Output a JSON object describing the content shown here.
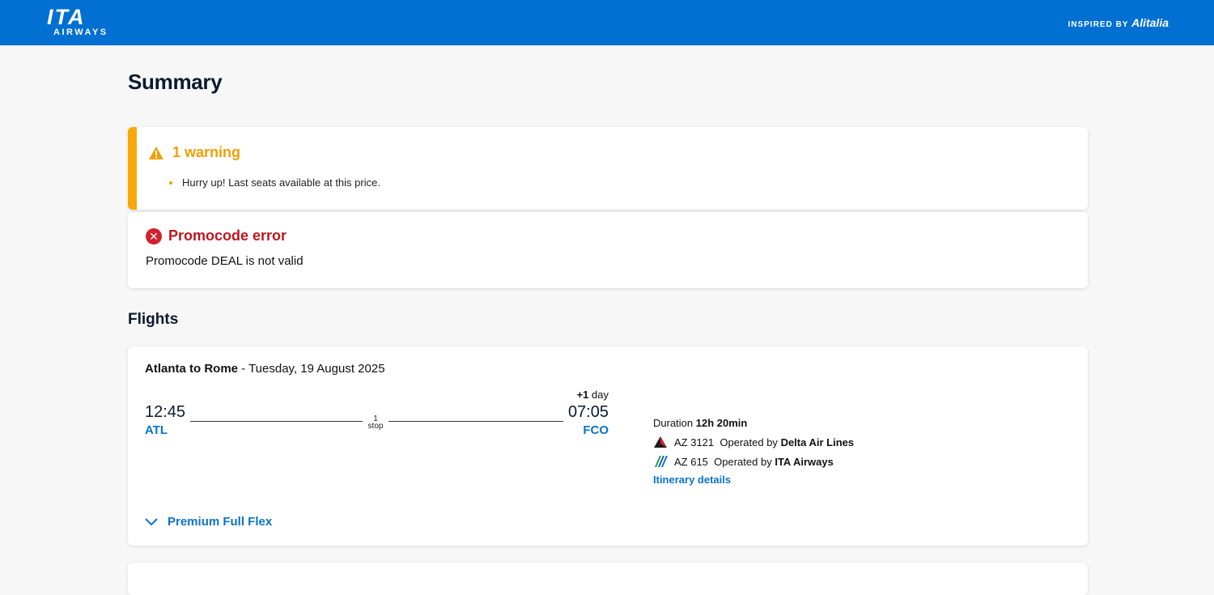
{
  "header": {
    "logo_main": "ITA",
    "logo_sub": "AIRWAYS",
    "inspired_prefix": "INSPIRED BY",
    "inspired_brand": "Alitalia",
    "bar_color": "#0170d2"
  },
  "page_title": "Summary",
  "warning": {
    "title": "1 warning",
    "icon": "warning-triangle-icon",
    "items": [
      "Hurry up! Last seats available at this price."
    ],
    "accent_color": "#f7a707"
  },
  "error": {
    "title": "Promocode error",
    "icon": "error-x-circle-icon",
    "message": "Promocode DEAL is not valid",
    "accent_color": "#c01620"
  },
  "flights_title": "Flights",
  "flight": {
    "route": "Atlanta to Rome",
    "separator": " - ",
    "date": "Tuesday, 19 August 2025",
    "departure": {
      "time": "12:45",
      "code": "ATL"
    },
    "arrival": {
      "time": "07:05",
      "code": "FCO",
      "day_offset": "+1",
      "day_offset_suffix": " day"
    },
    "stops_count": "1",
    "stops_word": "stop",
    "duration_label": "Duration",
    "duration_value": "12h 20min",
    "segments": [
      {
        "flight_no": "AZ 3121",
        "operated_label": "Operated by",
        "carrier": "Delta Air Lines",
        "icon": "delta-logo-icon"
      },
      {
        "flight_no": "AZ 615",
        "operated_label": "Operated by",
        "carrier": "ITA Airways",
        "icon": "ita-airways-logo-icon"
      }
    ],
    "itinerary_link": "Itinerary details",
    "fare_label": "Premium Full Flex",
    "fare_icon": "chevron-down-icon"
  },
  "link_color": "#0a73c9"
}
